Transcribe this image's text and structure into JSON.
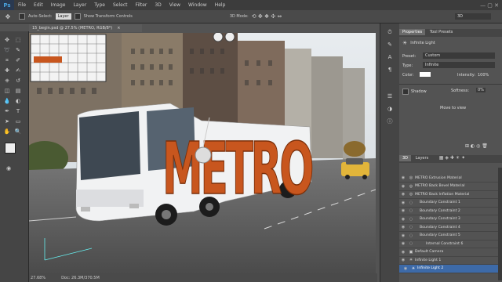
{
  "app": {
    "logo": "Ps"
  },
  "menu": [
    "File",
    "Edit",
    "Image",
    "Layer",
    "Type",
    "Select",
    "Filter",
    "3D",
    "View",
    "Window",
    "Help"
  ],
  "options": {
    "auto_select": "Auto-Select:",
    "auto_select_value": "Layer",
    "show_transform": "Show Transform Controls",
    "mode3d": "3D Mode:",
    "workspace": "3D"
  },
  "document": {
    "tab": "15_begin.psd @ 27.5% (METRO, RGB/8*)",
    "close": "×",
    "zoom": "27.68%",
    "doc_size": "Doc: 26.3M/370.5M"
  },
  "canvas": {
    "sign_text": "METRO"
  },
  "properties": {
    "tabs": [
      "Properties",
      "Tool Presets"
    ],
    "title": "Infinite Light",
    "preset_label": "Preset:",
    "preset_value": "Custom",
    "type_label": "Type:",
    "type_value": "Infinite",
    "color_label": "Color:",
    "intensity_label": "Intensity:",
    "intensity_value": "100%",
    "shadow_label": "Shadow",
    "softness_label": "Softness:",
    "softness_value": "0%",
    "move_to_view": "Move to view"
  },
  "layers": {
    "tabs": [
      "3D",
      "Layers"
    ],
    "items": [
      {
        "label": "METRO Extrusion Material",
        "selected": false
      },
      {
        "label": "METRO Back Bevel Material",
        "selected": false
      },
      {
        "label": "METRO Back Inflation Material",
        "selected": false
      },
      {
        "label": "Boundary Constraint 1",
        "selected": false
      },
      {
        "label": "Boundary Constraint 2",
        "selected": false
      },
      {
        "label": "Boundary Constraint 3",
        "selected": false
      },
      {
        "label": "Boundary Constraint 4",
        "selected": false
      },
      {
        "label": "Boundary Constraint 5",
        "selected": false
      },
      {
        "label": "Internal Constraint 6",
        "selected": false
      },
      {
        "label": "Default Camera",
        "selected": false
      },
      {
        "label": "Infinite Light 1",
        "selected": false
      },
      {
        "label": "Infinite Light 2",
        "selected": true
      }
    ]
  },
  "colors": {
    "accent": "#3d6aa8",
    "metro_orange": "#c8561e"
  }
}
